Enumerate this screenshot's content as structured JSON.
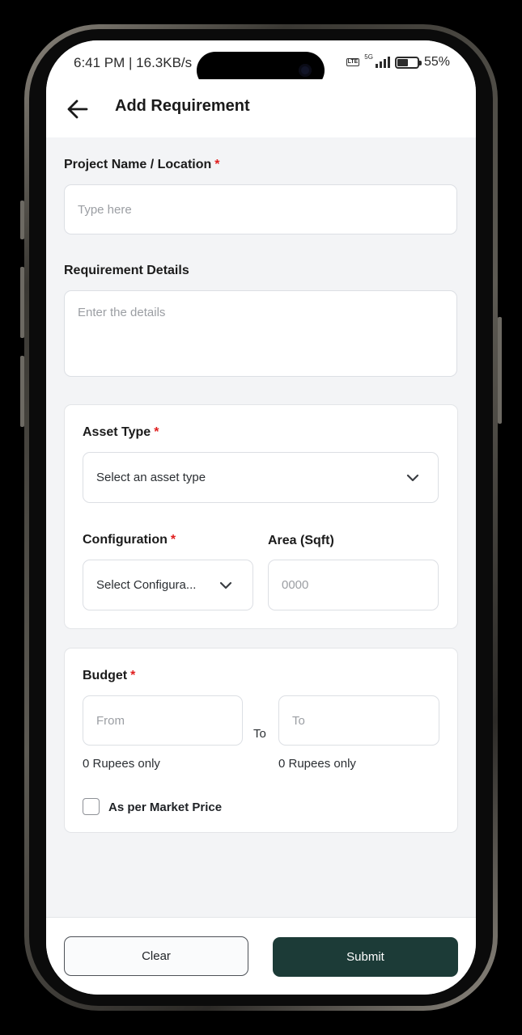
{
  "status_bar": {
    "time_speed": "6:41 PM | 16.3KB/s",
    "network": "5G",
    "lte_badge": "LTE",
    "battery": "55%"
  },
  "header": {
    "title": "Add Requirement",
    "back_icon": "arrow-left-icon"
  },
  "form": {
    "project": {
      "label": "Project Name / Location",
      "required": "*",
      "placeholder": "Type here"
    },
    "details": {
      "label": "Requirement Details",
      "placeholder": "Enter the details"
    },
    "asset_type": {
      "label": "Asset Type",
      "required": "*",
      "value": "Select an asset type"
    },
    "configuration": {
      "label": "Configuration",
      "required": "*",
      "value": "Select Configura..."
    },
    "area": {
      "label": "Area (Sqft)",
      "placeholder": "0000"
    },
    "budget": {
      "label": "Budget",
      "required": "*",
      "from_placeholder": "From",
      "to_placeholder": "To",
      "separator": "To",
      "from_helper": "0 Rupees only",
      "to_helper": "0 Rupees only"
    },
    "market_price": {
      "label": "As per Market Price",
      "checked": false
    }
  },
  "footer": {
    "clear_label": "Clear",
    "submit_label": "Submit"
  },
  "colors": {
    "accent": "#1c3b37",
    "required": "#e01e1e",
    "background": "#f3f4f6"
  }
}
